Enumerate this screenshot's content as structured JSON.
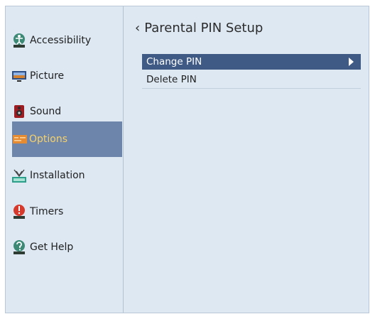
{
  "sidebar": {
    "items": [
      {
        "label": "Accessibility",
        "icon": "accessibility-icon"
      },
      {
        "label": "Picture",
        "icon": "picture-monitor-icon"
      },
      {
        "label": "Sound",
        "icon": "speaker-icon"
      },
      {
        "label": "Options",
        "icon": "options-panel-icon",
        "selected": true
      },
      {
        "label": "Installation",
        "icon": "antenna-icon"
      },
      {
        "label": "Timers",
        "icon": "timer-icon"
      },
      {
        "label": "Get Help",
        "icon": "help-icon"
      }
    ]
  },
  "main": {
    "title": "Parental PIN Setup",
    "back_icon": "chevron-left-icon",
    "menu": [
      {
        "label": "Change PIN",
        "active": true,
        "icon": "play-arrow-icon"
      },
      {
        "label": "Delete PIN",
        "active": false
      }
    ]
  },
  "colors": {
    "background": "#dde8f3",
    "selected_nav": "#6d84ab",
    "selected_nav_text": "#f6d26a",
    "active_row": "#3f5a85"
  }
}
